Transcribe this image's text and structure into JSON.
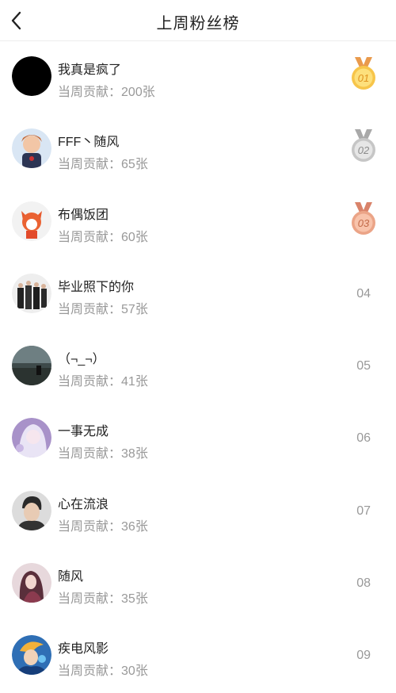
{
  "header": {
    "title": "上周粉丝榜"
  },
  "contrib_prefix": "当周贡献：",
  "items": [
    {
      "name": "我真是疯了",
      "contribution": "200张",
      "rank": "01",
      "medal": "gold"
    },
    {
      "name": "FFF丶随风",
      "contribution": "65张",
      "rank": "02",
      "medal": "silver"
    },
    {
      "name": "布偶饭团",
      "contribution": "60张",
      "rank": "03",
      "medal": "bronze"
    },
    {
      "name": "毕业照下的你",
      "contribution": "57张",
      "rank": "04"
    },
    {
      "name": "（¬_¬）",
      "contribution": "41张",
      "rank": "05"
    },
    {
      "name": "一事无成",
      "contribution": "38张",
      "rank": "06"
    },
    {
      "name": "心在流浪",
      "contribution": "36张",
      "rank": "07"
    },
    {
      "name": "随风",
      "contribution": "35张",
      "rank": "08"
    },
    {
      "name": "疾电风影",
      "contribution": "30张",
      "rank": "09"
    }
  ],
  "colors": {
    "gold": "#f5b731",
    "silver": "#b9b9b9",
    "bronze": "#e69b7c"
  }
}
